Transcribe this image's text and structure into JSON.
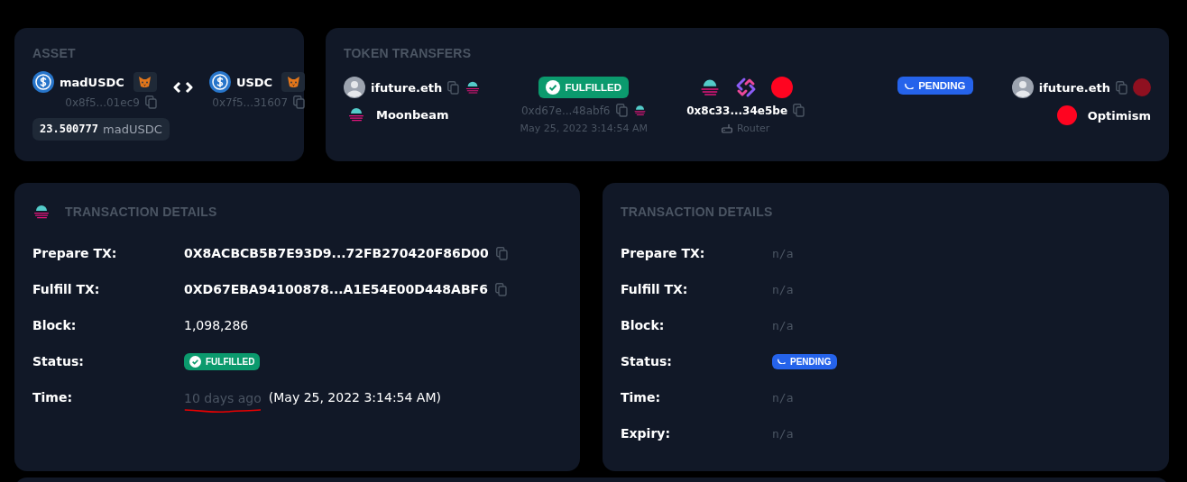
{
  "asset": {
    "title": "ASSET",
    "from": {
      "symbol": "madUSDC",
      "address": "0x8f5...01ec9"
    },
    "to": {
      "symbol": "USDC",
      "address": "0x7f5...31607"
    },
    "amount": {
      "value": "23.500777",
      "symbol": "madUSDC"
    }
  },
  "transfers": {
    "title": "TOKEN TRANSFERS",
    "sender": {
      "name": "ifuture.eth",
      "chain": "Moonbeam"
    },
    "source_status": {
      "kind": "fulfilled",
      "label": "FULFILLED",
      "hash": "0xd67e...48abf6",
      "time": "May 25, 2022 3:14:54 AM"
    },
    "router": {
      "address": "0x8c33...34e5be",
      "label": "Router"
    },
    "destination_status": {
      "kind": "pending",
      "label": "PENDING"
    },
    "receiver": {
      "name": "ifuture.eth",
      "chain": "Optimism"
    }
  },
  "details": [
    {
      "title": "TRANSACTION DETAILS",
      "rows": [
        {
          "label": "Prepare TX:",
          "kind": "hash",
          "value": "0X8ACBCB5B7E93D9...72FB270420F86D00"
        },
        {
          "label": "Fulfill TX:",
          "kind": "hash",
          "value": "0XD67EBA94100878...A1E54E00D448ABF6"
        },
        {
          "label": "Block:",
          "kind": "text",
          "value": "1,098,286"
        },
        {
          "label": "Status:",
          "kind": "status",
          "badge": {
            "kind": "fulfilled",
            "label": "FULFILLED"
          }
        },
        {
          "label": "Time:",
          "kind": "time",
          "relative": "10 days ago",
          "value": "(May 25, 2022 3:14:54 AM)",
          "underlined": true
        }
      ]
    },
    {
      "title": "TRANSACTION DETAILS",
      "rows": [
        {
          "label": "Prepare TX:",
          "kind": "na",
          "value": "n/a"
        },
        {
          "label": "Fulfill TX:",
          "kind": "na",
          "value": "n/a"
        },
        {
          "label": "Block:",
          "kind": "na",
          "value": "n/a"
        },
        {
          "label": "Status:",
          "kind": "status",
          "badge": {
            "kind": "pending",
            "label": "PENDING"
          }
        },
        {
          "label": "Time:",
          "kind": "na",
          "value": "n/a"
        },
        {
          "label": "Expiry:",
          "kind": "na",
          "value": "n/a"
        }
      ]
    }
  ]
}
